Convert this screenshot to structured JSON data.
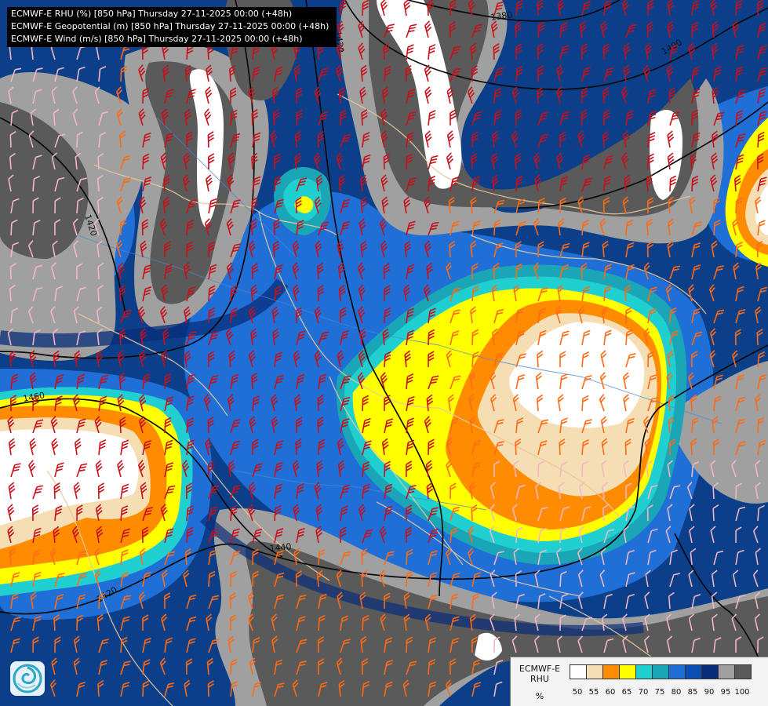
{
  "title_lines": [
    "ECMWF-E RHU (%) [850 hPa] Thursday 27-11-2025 00:00 (+48h)",
    "ECMWF-E Geopotential (m) [850 hPa] Thursday 27-11-2025 00:00 (+48h)",
    "ECMWF-E Wind (m/s) [850 hPa] Thursday 27-11-2025 00:00 (+48h)"
  ],
  "legend": {
    "title_line1": "ECMWF-E",
    "title_line2": "RHU",
    "unit": "%",
    "colors": [
      "#ffffff",
      "#f5deb3",
      "#ff8c00",
      "#ffff00",
      "#20d0d0",
      "#1aa6b7",
      "#1f6fd6",
      "#0b4fb4",
      "#082d7a",
      "#a0a0a0",
      "#5a5a5a"
    ],
    "ticks": [
      "50",
      "55",
      "60",
      "65",
      "70",
      "75",
      "80",
      "85",
      "90",
      "95",
      "100"
    ]
  },
  "contour_labels": [
    "1380",
    "1400",
    "1420",
    "1420",
    "1460",
    "1440",
    "1420"
  ],
  "logo_icon": "ecmwf-swirl-icon",
  "map_colors": {
    "deep_blue": "#0b3f8a",
    "mid_blue": "#1f6fd6",
    "navy": "#082d7a",
    "gray_light": "#a0a0a0",
    "gray_dark": "#5a5a5a",
    "white": "#ffffff",
    "wheat": "#f5deb3",
    "orange": "#ff8c00",
    "yellow": "#ffff00",
    "cyan": "#20d0d0",
    "teal": "#1aa6b7",
    "wind_red": "#c8101a",
    "wind_orange": "#ff6a14",
    "wind_pink": "#f4b6c4",
    "border_tan": "#e6c89a",
    "river_blue": "#4a86d8"
  }
}
